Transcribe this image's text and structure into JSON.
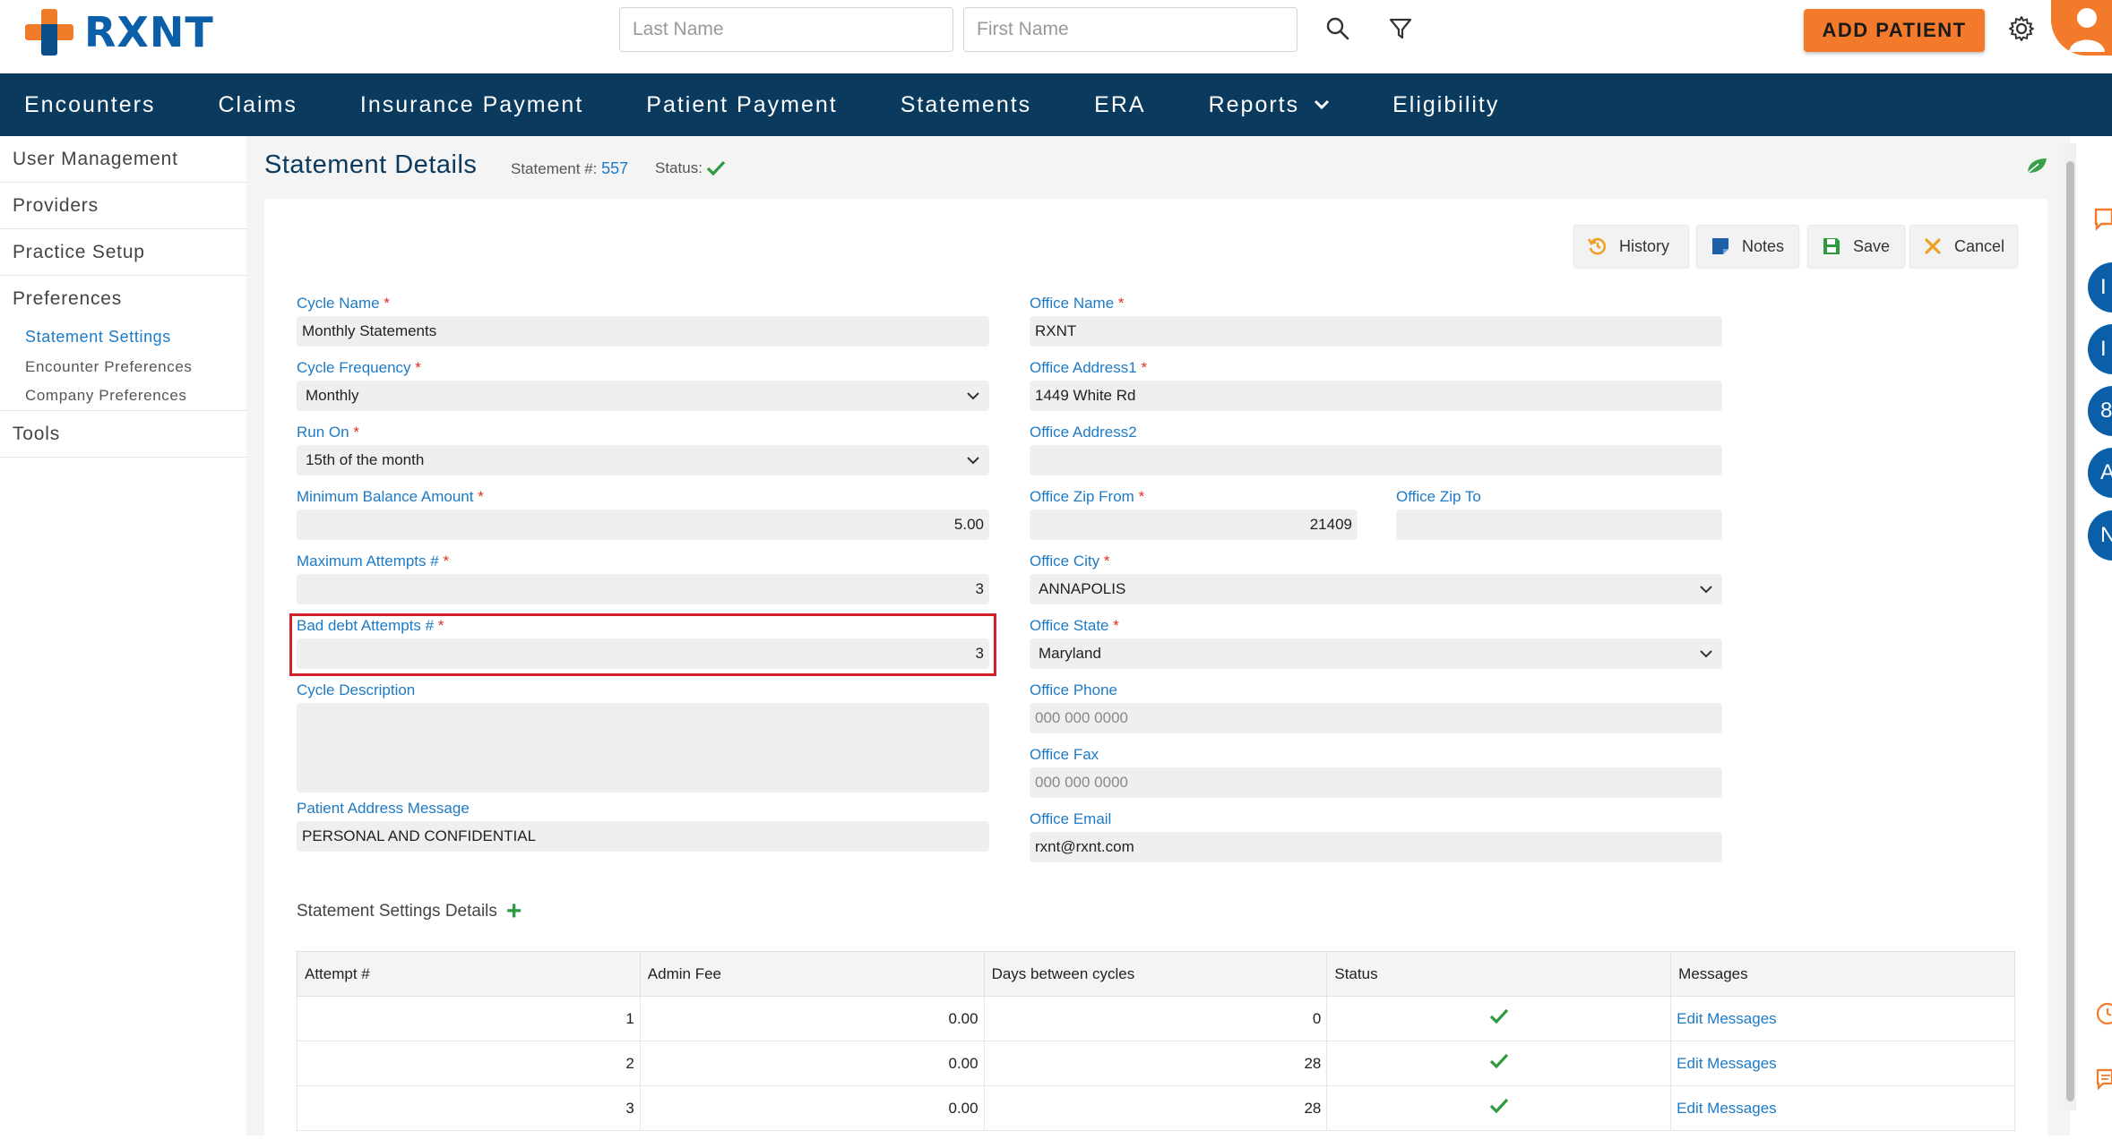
{
  "header": {
    "logo_text": "RXNT",
    "last_name_placeholder": "Last Name",
    "first_name_placeholder": "First Name",
    "add_patient_label": "ADD PATIENT"
  },
  "nav": {
    "items": [
      {
        "label": "Encounters"
      },
      {
        "label": "Claims"
      },
      {
        "label": "Insurance Payment"
      },
      {
        "label": "Patient Payment"
      },
      {
        "label": "Statements"
      },
      {
        "label": "ERA"
      },
      {
        "label": "Reports"
      },
      {
        "label": "Eligibility"
      }
    ]
  },
  "sidebar": {
    "user_management": "User Management",
    "providers": "Providers",
    "practice_setup": "Practice Setup",
    "preferences": "Preferences",
    "statement_settings": "Statement Settings",
    "encounter_preferences": "Encounter Preferences",
    "company_preferences": "Company Preferences",
    "tools": "Tools"
  },
  "page": {
    "title": "Statement Details",
    "statement_label": "Statement #:",
    "statement_number": "557",
    "status_label": "Status:"
  },
  "toolbar": {
    "history": "History",
    "notes": "Notes",
    "save": "Save",
    "cancel": "Cancel"
  },
  "form": {
    "cycle_name_label": "Cycle Name",
    "cycle_name": "Monthly Statements",
    "cycle_frequency_label": "Cycle Frequency",
    "cycle_frequency": "Monthly",
    "run_on_label": "Run On",
    "run_on": "15th of the month",
    "min_balance_label": "Minimum Balance Amount",
    "min_balance": "5.00",
    "max_attempts_label": "Maximum Attempts #",
    "max_attempts": "3",
    "bad_debt_label": "Bad debt Attempts #",
    "bad_debt": "3",
    "cycle_description_label": "Cycle Description",
    "cycle_description": "",
    "patient_address_message_label": "Patient Address Message",
    "patient_address_message": "PERSONAL AND CONFIDENTIAL",
    "office_name_label": "Office Name",
    "office_name": "RXNT",
    "office_address1_label": "Office Address1",
    "office_address1": "1449 White Rd",
    "office_address2_label": "Office Address2",
    "office_address2": "",
    "office_zip_from_label": "Office Zip From",
    "office_zip_from": "21409",
    "office_zip_to_label": "Office Zip To",
    "office_zip_to": "",
    "office_city_label": "Office City",
    "office_city": "ANNAPOLIS",
    "office_state_label": "Office State",
    "office_state": "Maryland",
    "office_phone_label": "Office Phone",
    "office_phone_placeholder": "000 000 0000",
    "office_fax_label": "Office Fax",
    "office_fax_placeholder": "000 000 0000",
    "office_email_label": "Office Email",
    "office_email": "rxnt@rxnt.com",
    "required_marker": "*"
  },
  "details": {
    "title": "Statement Settings Details",
    "columns": [
      "Attempt #",
      "Admin Fee",
      "Days between cycles",
      "Status",
      "Messages"
    ],
    "rows": [
      {
        "attempt": "1",
        "admin_fee": "0.00",
        "days": "0",
        "message_link": "Edit Messages"
      },
      {
        "attempt": "2",
        "admin_fee": "0.00",
        "days": "28",
        "message_link": "Edit Messages"
      },
      {
        "attempt": "3",
        "admin_fee": "0.00",
        "days": "28",
        "message_link": "Edit Messages"
      }
    ]
  },
  "right_rail": {
    "bubbles": [
      "I",
      "I",
      "8",
      "A",
      "N"
    ]
  },
  "colors": {
    "nav_bg": "#0a3a5e",
    "accent_orange": "#f37a2b",
    "link_blue": "#1d7ac4",
    "success_green": "#2e9a3f",
    "highlight_red": "#d0202a"
  }
}
